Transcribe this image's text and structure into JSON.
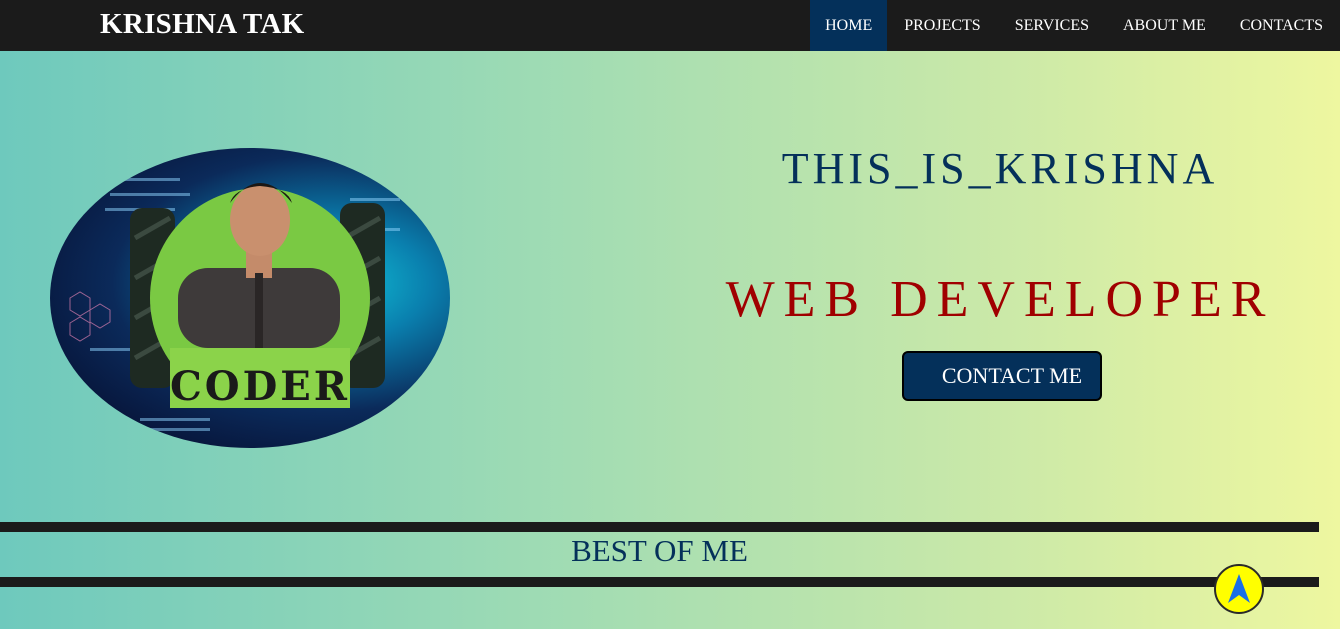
{
  "navbar": {
    "brand": "KRISHNA TAK",
    "items": [
      {
        "label": "HOME",
        "active": true
      },
      {
        "label": "PROJECTS",
        "active": false
      },
      {
        "label": "SERVICES",
        "active": false
      },
      {
        "label": "ABOUT ME",
        "active": false
      },
      {
        "label": "CONTACTS",
        "active": false
      }
    ]
  },
  "hero": {
    "handle": "THIS_IS_KRISHNA",
    "role": "WEB DEVELOPER",
    "contact_button": "CONTACT ME",
    "badge_text": "CODER"
  },
  "section": {
    "title": "BEST OF ME"
  },
  "colors": {
    "navbar_bg": "#1b1b1b",
    "accent_navy": "#04305a",
    "role_red": "#a00000",
    "scroll_button": "#ffff00"
  },
  "icons": {
    "scroll_top": "arrow-up-icon"
  }
}
